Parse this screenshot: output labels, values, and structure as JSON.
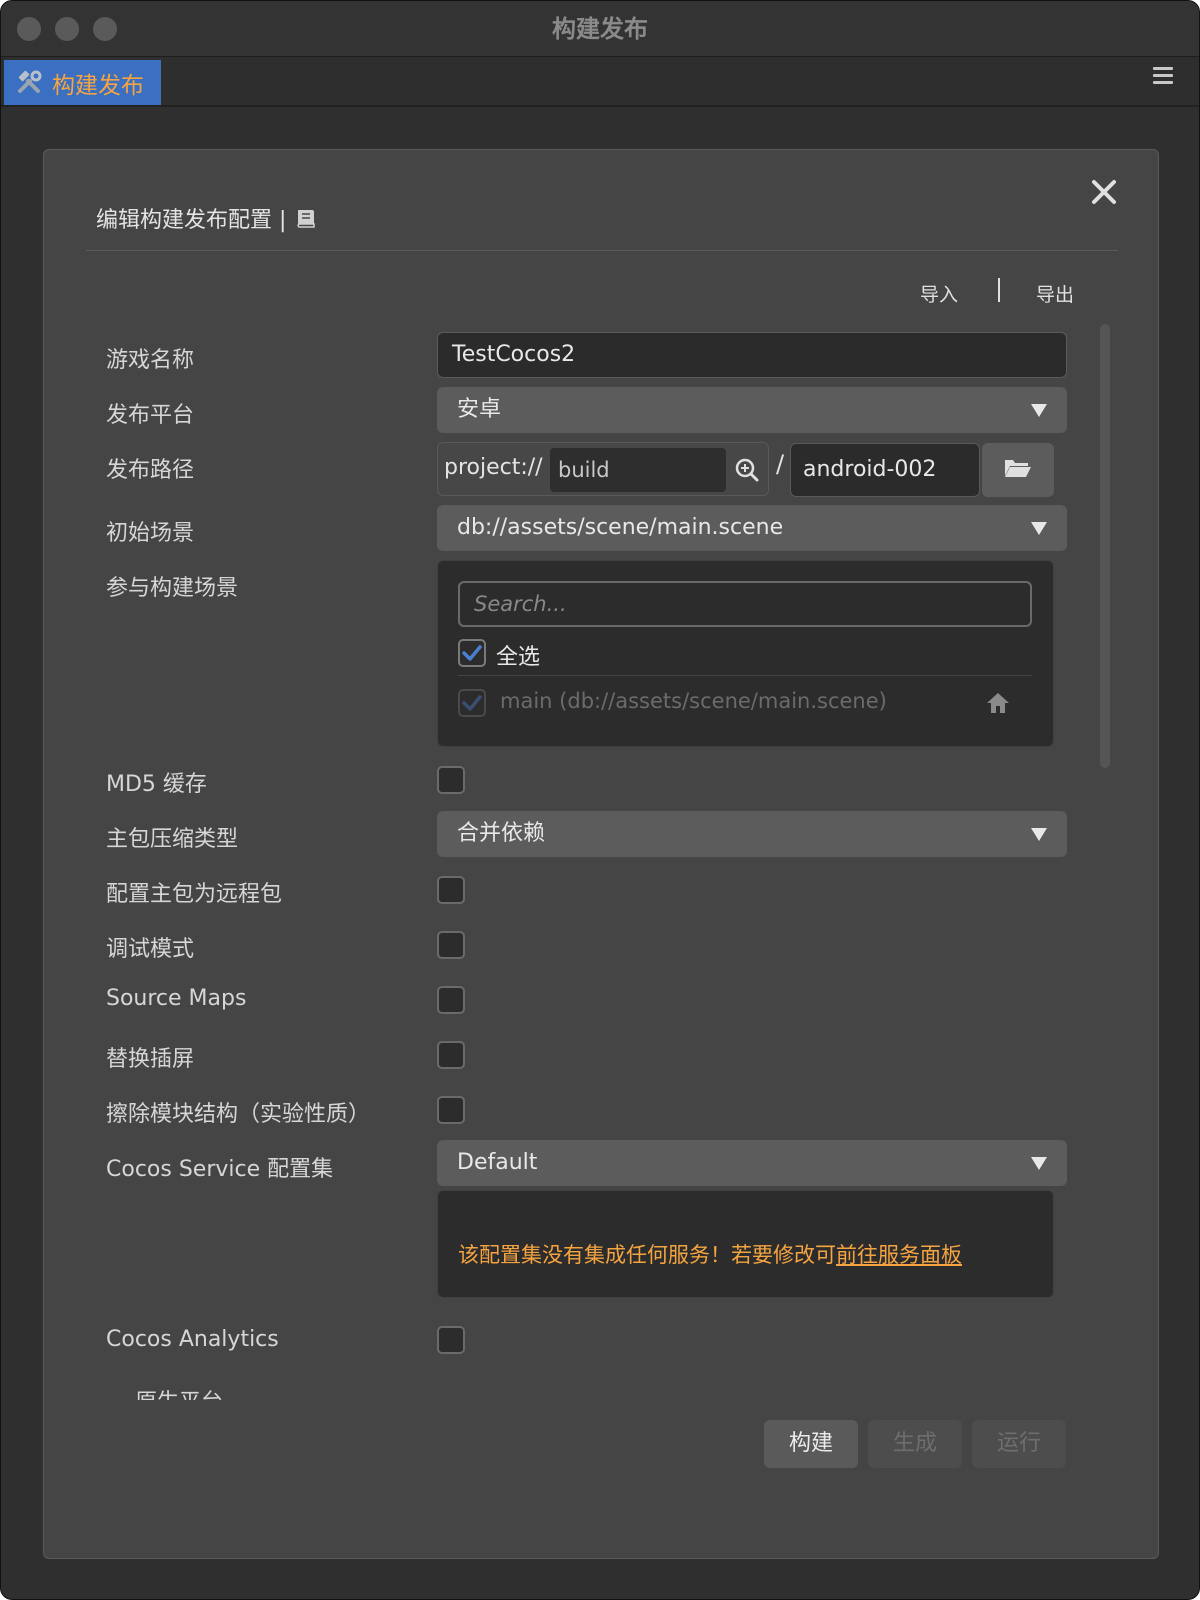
{
  "window": {
    "title": "构建发布"
  },
  "tab": {
    "label": "构建发布",
    "icon": "hammer-wrench-icon"
  },
  "dialog": {
    "title": "编辑构建发布配置 |",
    "import_label": "导入",
    "export_label": "导出",
    "close_icon": "close-icon",
    "doc_icon": "book-icon"
  },
  "fields": {
    "game_name": {
      "label": "游戏名称",
      "value": "TestCocos2"
    },
    "platform": {
      "label": "发布平台",
      "value": "安卓"
    },
    "build_path": {
      "label": "发布路径",
      "prefix": "project://",
      "dir": "build",
      "name": "android-002"
    },
    "start_scene": {
      "label": "初始场景",
      "value": "db://assets/scene/main.scene"
    },
    "scenes": {
      "label": "参与构建场景",
      "search_placeholder": "Search...",
      "select_all": "全选",
      "select_all_checked": true,
      "items": [
        {
          "name": "main",
          "path": "(db://assets/scene/main.scene)",
          "checked": true
        }
      ]
    },
    "md5": {
      "label": "MD5 缓存",
      "checked": false
    },
    "compression": {
      "label": "主包压缩类型",
      "value": "合并依赖"
    },
    "remote_main": {
      "label": "配置主包为远程包",
      "checked": false
    },
    "debug": {
      "label": "调试模式",
      "checked": false
    },
    "source_maps": {
      "label": "Source Maps",
      "checked": false
    },
    "splash": {
      "label": "替换插屏",
      "checked": false
    },
    "erase_modules": {
      "label": "擦除模块结构（实验性质）",
      "checked": false
    },
    "service": {
      "label": "Cocos Service 配置集",
      "value": "Default",
      "message": "该配置集没有集成任何服务！若要修改可",
      "link": "前往服务面板"
    },
    "analytics": {
      "label": "Cocos Analytics",
      "checked": false
    },
    "native_section": "— 原生平台"
  },
  "buttons": {
    "build": "构建",
    "generate": "生成",
    "run": "运行"
  },
  "colors": {
    "accent": "#f5a441",
    "tab_bg": "#3a6fc1",
    "check": "#4a7fd0"
  }
}
